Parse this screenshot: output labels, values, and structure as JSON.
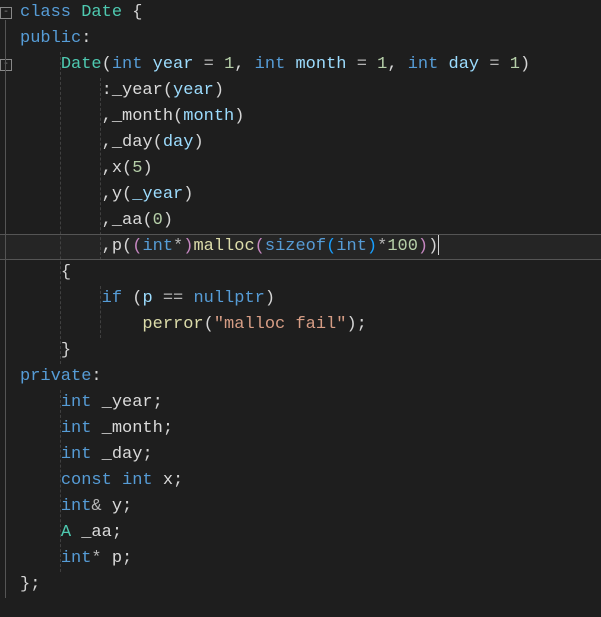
{
  "code": {
    "l1": {
      "kw_class": "class",
      "cls_date": "Date",
      "brace": "{"
    },
    "l2": {
      "kw_public": "public",
      "colon": ":"
    },
    "l3": {
      "cls_date": "Date",
      "lp": "(",
      "t_int1": "int",
      "p_year": "year",
      "eq1": "=",
      "n1": "1",
      "c1": ",",
      "t_int2": "int",
      "p_month": "month",
      "eq2": "=",
      "n2": "1",
      "c2": ",",
      "t_int3": "int",
      "p_day": "day",
      "eq3": "=",
      "n3": "1",
      "rp": ")"
    },
    "l4": {
      "colon": ":",
      "m_year": "_year",
      "lp": "(",
      "v_year": "year",
      "rp": ")"
    },
    "l5": {
      "comma": ",",
      "m_month": "_month",
      "lp": "(",
      "v_month": "month",
      "rp": ")"
    },
    "l6": {
      "comma": ",",
      "m_day": "_day",
      "lp": "(",
      "v_day": "day",
      "rp": ")"
    },
    "l7": {
      "comma": ",",
      "mx": "x",
      "lp": "(",
      "n5": "5",
      "rp": ")"
    },
    "l8": {
      "comma": ",",
      "my": "y",
      "lp": "(",
      "v_year": "_year",
      "rp": ")"
    },
    "l9": {
      "comma": ",",
      "maa": "_aa",
      "lp": "(",
      "n0": "0",
      "rp": ")"
    },
    "l10": {
      "comma": ",",
      "mp": "p",
      "lp1": "(",
      "lp2": "(",
      "t_int": "int",
      "star": "*",
      "rp2": ")",
      "fn_malloc": "malloc",
      "lp3": "(",
      "fn_sizeof": "sizeof",
      "lp4": "(",
      "t_int2": "int",
      "rp4": ")",
      "mul": "*",
      "n100": "100",
      "rp3": ")",
      "rp1": ")"
    },
    "l11": {
      "brace": "{"
    },
    "l12": {
      "kw_if": "if",
      "lp": "(",
      "vp": "p",
      "eqeq": "==",
      "kw_null": "nullptr",
      "rp": ")"
    },
    "l13": {
      "fn_perror": "perror",
      "lp": "(",
      "str": "\"malloc fail\"",
      "rp": ")",
      "semi": ";"
    },
    "l14": {
      "brace": "}"
    },
    "l15": {
      "kw_private": "private",
      "colon": ":"
    },
    "l16": {
      "t_int": "int",
      "m": "_year",
      "semi": ";"
    },
    "l17": {
      "t_int": "int",
      "m": "_month",
      "semi": ";"
    },
    "l18": {
      "t_int": "int",
      "m": "_day",
      "semi": ";"
    },
    "l19": {
      "kw_const": "const",
      "t_int": "int",
      "m": "x",
      "semi": ";"
    },
    "l20": {
      "t_int": "int",
      "amp": "&",
      "m": "y",
      "semi": ";"
    },
    "l21": {
      "cls_a": "A",
      "m": "_aa",
      "semi": ";"
    },
    "l22": {
      "t_int": "int",
      "star": "*",
      "m": "p",
      "semi": ";"
    },
    "l23": {
      "brace": "}",
      "semi": ";"
    }
  }
}
